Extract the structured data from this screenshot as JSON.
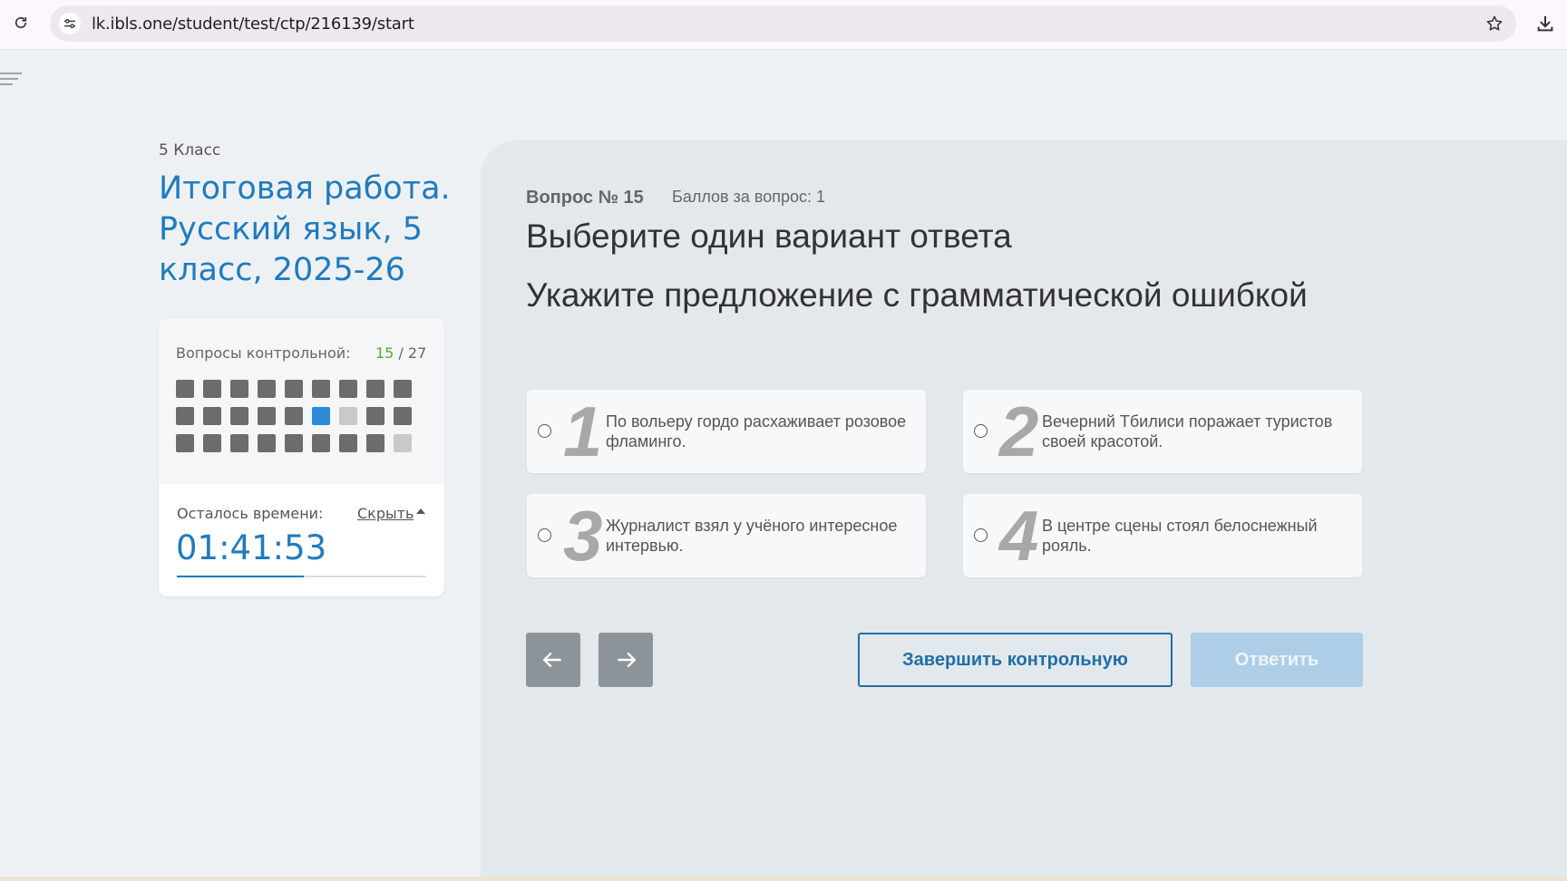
{
  "browser": {
    "url": "lk.ibls.one/student/test/ctp/216139/start"
  },
  "sidebar": {
    "grade": "5 Класс",
    "test_title": "Итоговая работа. Русский язык, 5 класс, 2025-26",
    "questions_label": "Вопросы контрольной:",
    "current_question": "15",
    "separator": " / ",
    "total_questions": "27",
    "question_grid": [
      "answered",
      "answered",
      "answered",
      "answered",
      "answered",
      "answered",
      "answered",
      "answered",
      "answered",
      "answered",
      "answered",
      "answered",
      "answered",
      "answered",
      "current",
      "unanswered",
      "answered",
      "answered",
      "answered",
      "answered",
      "answered",
      "answered",
      "answered",
      "answered",
      "answered",
      "answered",
      "unanswered"
    ],
    "time_left_label": "Осталось времени:",
    "hide_link": "Скрыть",
    "timer": "01:41:53",
    "timer_progress_fraction": 0.51
  },
  "question": {
    "number_label": "Вопрос № 15",
    "points_label": "Баллов за вопрос: 1",
    "instruction": "Выберите один вариант ответа",
    "text": "Укажите предложение с грамматической ошибкой",
    "options": [
      {
        "num": "1",
        "text": "По вольеру гордо расхаживает розовое фламинго."
      },
      {
        "num": "2",
        "text": "Вечерний Тбилиси поражает туристов своей красотой."
      },
      {
        "num": "3",
        "text": "Журналист взял у учёного интересное интервью."
      },
      {
        "num": "4",
        "text": "В центре сцены стоял белоснежный рояль."
      }
    ]
  },
  "actions": {
    "prev_icon": "arrow-left-icon",
    "next_icon": "arrow-right-icon",
    "finish_label": "Завершить контрольную",
    "answer_label": "Ответить"
  },
  "colors": {
    "accent_blue": "#1f7bbf",
    "current_green": "#5aa832",
    "answered_square": "#6c6c6c",
    "current_square": "#2b8ad8",
    "unanswered_square": "#c9c9c9"
  }
}
